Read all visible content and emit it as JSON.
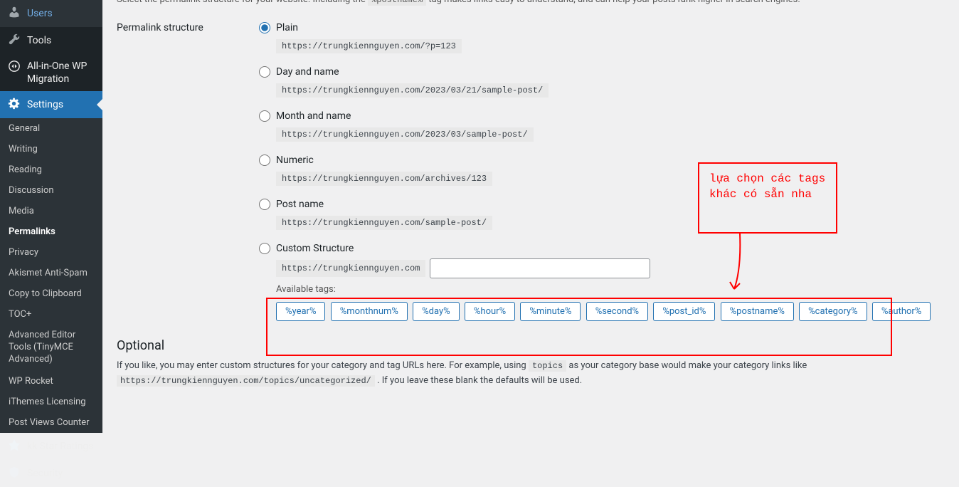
{
  "sidebar": {
    "items": [
      {
        "label": "Users",
        "icon": "user"
      },
      {
        "label": "Tools",
        "icon": "tool"
      },
      {
        "label": "All-in-One WP\nMigration",
        "icon": "migrate"
      },
      {
        "label": "Settings",
        "icon": "settings",
        "active": true
      },
      {
        "label": "kk Star Ratings",
        "icon": "star"
      },
      {
        "label": "Security",
        "icon": "shield"
      }
    ],
    "subItems": [
      "General",
      "Writing",
      "Reading",
      "Discussion",
      "Media",
      "Permalinks",
      "Privacy",
      "Akismet Anti-Spam",
      "Copy to Clipboard",
      "TOC+",
      "Advanced Editor Tools (TinyMCE Advanced)",
      "WP Rocket",
      "iThemes Licensing",
      "Post Views Counter"
    ],
    "activeSub": "Permalinks"
  },
  "intro": {
    "text_prefix": "Select the permalink structure for your website. Including the ",
    "code": "%postname%",
    "text_suffix": " tag makes links easy to understand, and can help your posts rank higher in search engines."
  },
  "formLabel": "Permalink structure",
  "radios": [
    {
      "name": "Plain",
      "code": "https://trungkiennguyen.com/?p=123",
      "checked": true
    },
    {
      "name": "Day and name",
      "code": "https://trungkiennguyen.com/2023/03/21/sample-post/"
    },
    {
      "name": "Month and name",
      "code": "https://trungkiennguyen.com/2023/03/sample-post/"
    },
    {
      "name": "Numeric",
      "code": "https://trungkiennguyen.com/archives/123"
    },
    {
      "name": "Post name",
      "code": "https://trungkiennguyen.com/sample-post/"
    }
  ],
  "custom": {
    "label": "Custom Structure",
    "prefix": "https://trungkiennguyen.com",
    "value": ""
  },
  "tagsLabel": "Available tags:",
  "tags": [
    "%year%",
    "%monthnum%",
    "%day%",
    "%hour%",
    "%minute%",
    "%second%",
    "%post_id%",
    "%postname%",
    "%category%",
    "%author%"
  ],
  "optional": {
    "title": "Optional",
    "text1": "If you like, you may enter custom structures for your category and tag URLs here. For example, using ",
    "code1": "topics",
    "text2": " as your category base would make your category links like ",
    "code2": "https://trungkiennguyen.com/topics/uncategorized/",
    "text3": " . If you leave these blank the defaults will be used."
  },
  "annotation": {
    "text": "lựa chọn các tags\nkhác có sẵn nha"
  }
}
